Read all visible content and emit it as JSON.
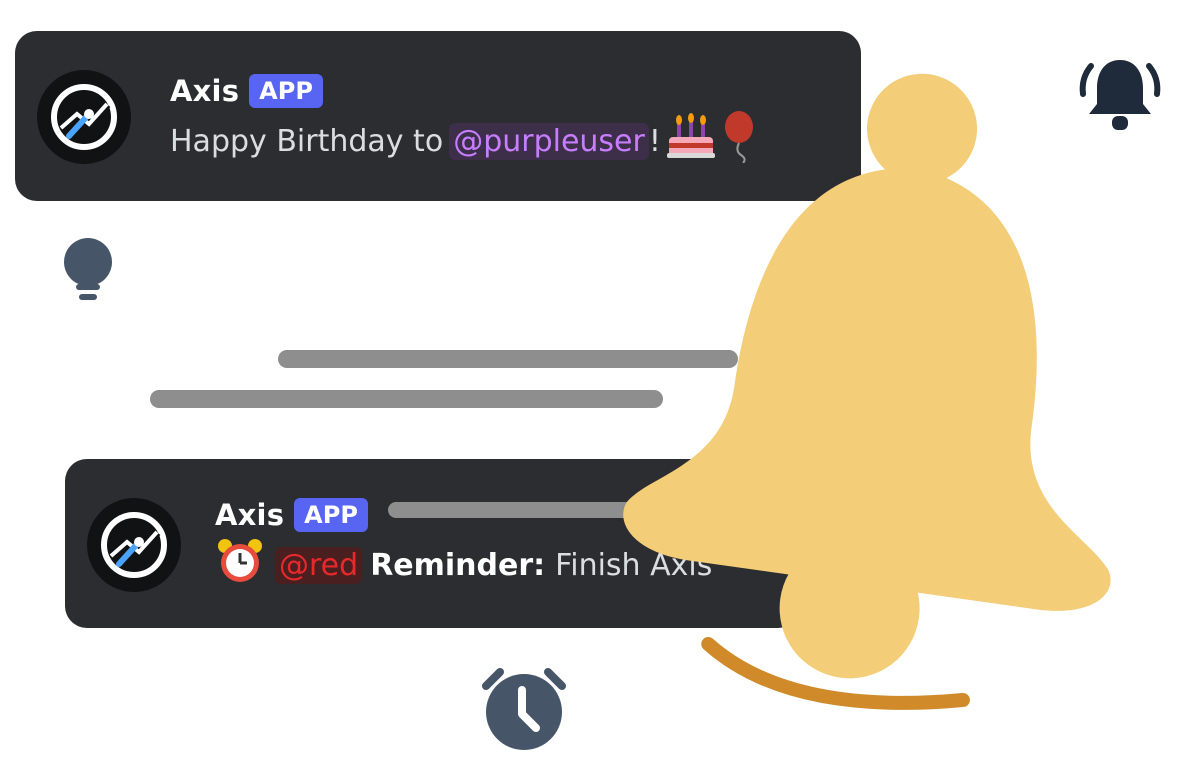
{
  "message1": {
    "username": "Axis",
    "badge": "APP",
    "text_before": "Happy Birthday to",
    "mention": "@purpleuser",
    "text_after": "!",
    "emojis": [
      "cake-emoji",
      "balloon-emoji"
    ]
  },
  "message2": {
    "username": "Axis",
    "badge": "APP",
    "mention": "@red",
    "bold_label": "Reminder:",
    "text": "Finish Axis",
    "emojis": [
      "alarm-clock-emoji"
    ]
  },
  "icons": [
    "bell-ringing-icon",
    "lightbulb-icon",
    "alarm-clock-icon",
    "large-bell-icon"
  ],
  "colors": {
    "card_bg": "#2b2d31",
    "badge_bg": "#5865f2",
    "purple_mention": "#c77dff",
    "red_mention": "#e8282b",
    "bell_yellow": "#f3cd77",
    "bell_clapper": "#d08a2a",
    "icon_slate": "#475569"
  }
}
